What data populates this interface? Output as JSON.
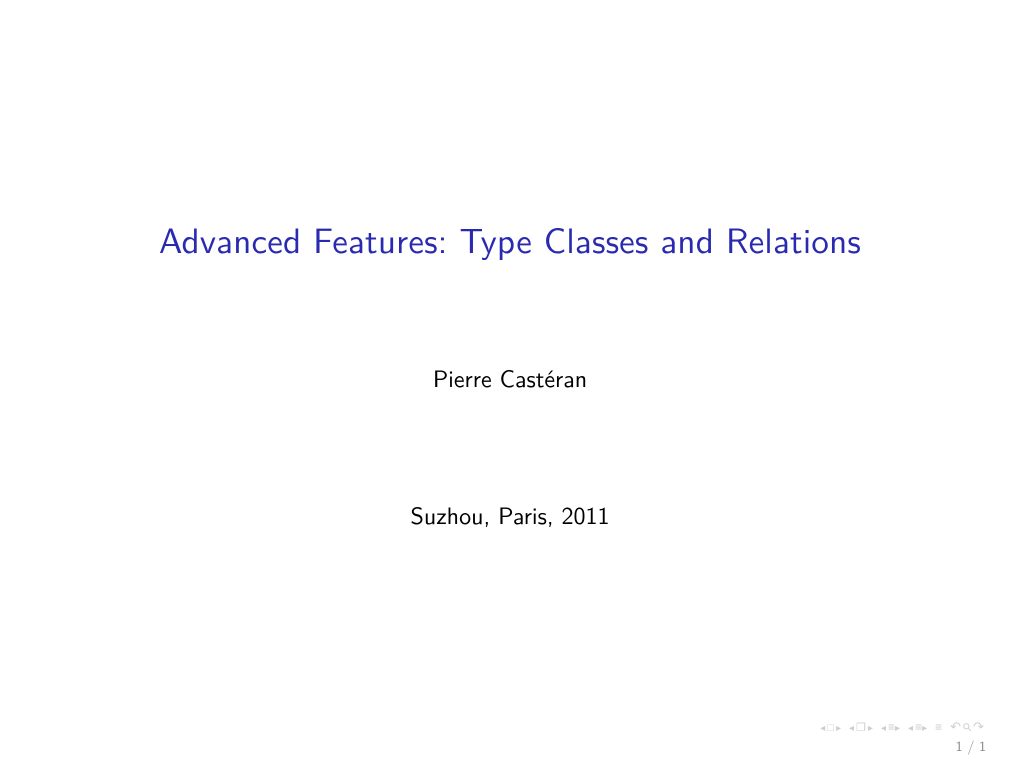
{
  "slide": {
    "title": "Advanced Features: Type Classes and Relations",
    "author": "Pierre Castéran",
    "venue": "Suzhou, Paris, 2011"
  },
  "footer": {
    "page": "1 / 1"
  }
}
